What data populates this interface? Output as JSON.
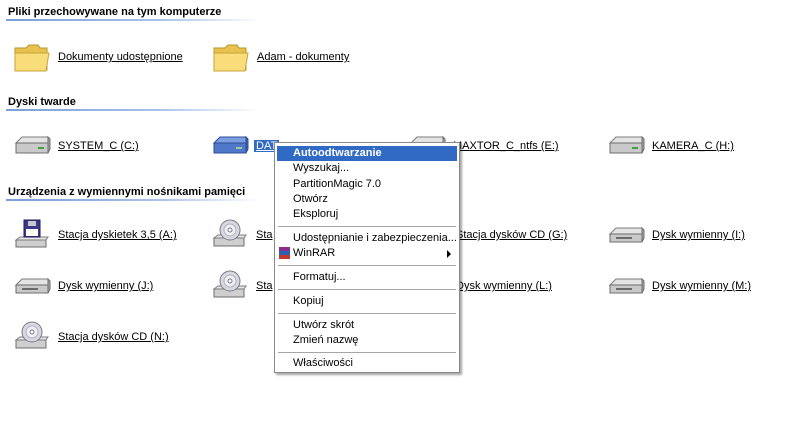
{
  "sections": {
    "files": "Pliki przechowywane na tym komputerze",
    "hard_disks": "Dyski twarde",
    "removable": "Urządzenia z wymiennymi nośnikami pamięci"
  },
  "items": {
    "shared_docs": "Dokumenty udostępnione",
    "adam_docs": "Adam - dokumenty",
    "system_c": "SYSTEM_C (C:)",
    "data_d": "DAT",
    "maxtor_e": "MAXTOR_C_ntfs (E:)",
    "kamera_h": "KAMERA_C (H:)",
    "floppy_a": "Stacja dyskietek 3,5 (A:)",
    "cd_f": "Sta",
    "cd_g": "Stacja dysków CD (G:)",
    "removable_i": "Dysk wymienny (I:)",
    "removable_j": "Dysk wymienny (J:)",
    "cd_k": "Sta",
    "removable_l": "Dysk wymienny (L:)",
    "removable_m": "Dysk wymienny (M:)",
    "cd_n": "Stacja dysków CD (N:)"
  },
  "menu": {
    "autoplay": "Autoodtwarzanie",
    "search": "Wyszukaj...",
    "partition_magic": "PartitionMagic 7.0",
    "open": "Otwórz",
    "explore": "Eksploruj",
    "sharing": "Udostępnianie i zabezpieczenia...",
    "winrar": "WinRAR",
    "format": "Formatuj...",
    "copy": "Kopiuj",
    "shortcut": "Utwórz skrót",
    "rename": "Zmień nazwę",
    "properties": "Właściwości"
  },
  "colors": {
    "menu_highlight": "#316ac5",
    "section_rule": "#7a9fd6",
    "folder": "#f5d56a",
    "drive": "#c8c8c8",
    "selected_drive": "#4f78c8"
  }
}
